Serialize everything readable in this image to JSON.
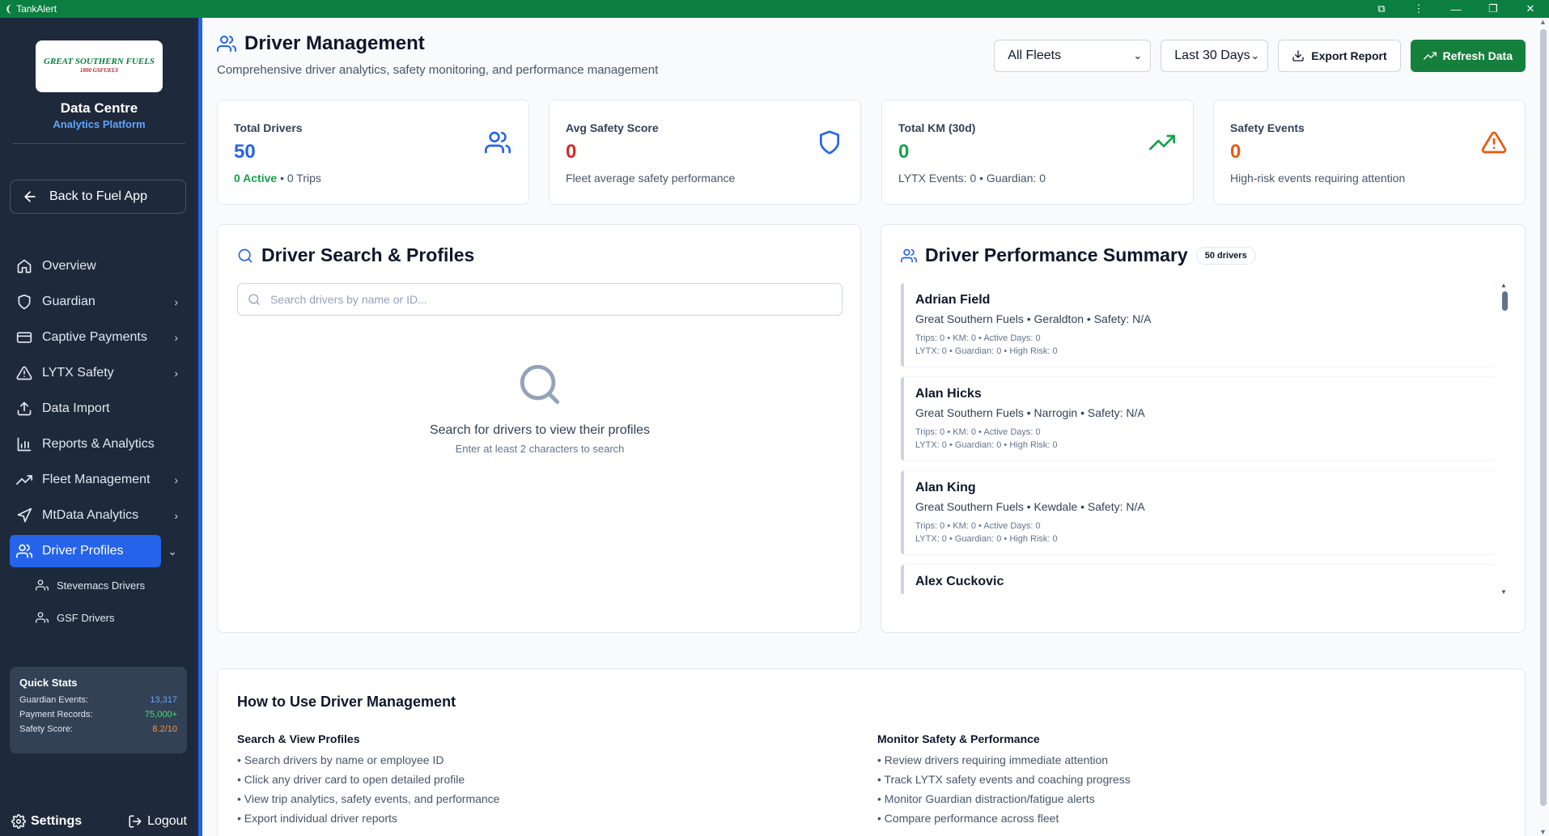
{
  "window": {
    "title": "TankAlert"
  },
  "sidebar": {
    "brand_title": "Data Centre",
    "brand_subtitle": "Analytics Platform",
    "logo_line1": "GREAT SOUTHERN FUELS",
    "logo_line2": "1800 GSFUELS",
    "back_label": "Back to Fuel App",
    "nav": [
      {
        "label": "Overview",
        "icon": "home-icon"
      },
      {
        "label": "Guardian",
        "icon": "shield-icon"
      },
      {
        "label": "Captive Payments",
        "icon": "credit-card-icon"
      },
      {
        "label": "LYTX Safety",
        "icon": "alert-triangle-icon"
      },
      {
        "label": "Data Import",
        "icon": "upload-icon"
      },
      {
        "label": "Reports & Analytics",
        "icon": "bar-chart-icon"
      },
      {
        "label": "Fleet Management",
        "icon": "trending-up-icon"
      },
      {
        "label": "MtData Analytics",
        "icon": "navigation-icon"
      },
      {
        "label": "Driver Profiles",
        "icon": "users-icon"
      }
    ],
    "subnav": [
      {
        "label": "Stevemacs Drivers"
      },
      {
        "label": "GSF Drivers"
      }
    ],
    "quick_stats": {
      "title": "Quick Stats",
      "rows": [
        {
          "label": "Guardian Events:",
          "value": "13,317",
          "color": "#60a5fa"
        },
        {
          "label": "Payment Records:",
          "value": "75,000+",
          "color": "#4ade80"
        },
        {
          "label": "Safety Score:",
          "value": "8.2/10",
          "color": "#fb923c"
        }
      ]
    },
    "settings_label": "Settings",
    "logout_label": "Logout"
  },
  "header": {
    "title": "Driver Management",
    "description": "Comprehensive driver analytics, safety monitoring, and performance management",
    "fleet_select": "All Fleets",
    "period_select": "Last 30 Days",
    "export_label": "Export Report",
    "refresh_label": "Refresh Data"
  },
  "stats": [
    {
      "label": "Total Drivers",
      "value": "50",
      "sub_a": "0 Active",
      "sub_b": " • 0 Trips",
      "color": "#2563eb",
      "icon": "users-icon"
    },
    {
      "label": "Avg Safety Score",
      "value": "0",
      "sub": "Fleet average safety performance",
      "color": "#dc2626",
      "icon": "shield-icon"
    },
    {
      "label": "Total KM (30d)",
      "value": "0",
      "sub": "LYTX Events: 0 • Guardian: 0",
      "color": "#16a34a",
      "icon": "trending-up-icon"
    },
    {
      "label": "Safety Events",
      "value": "0",
      "sub": "High-risk events requiring attention",
      "color": "#ea580c",
      "icon": "alert-triangle-icon"
    }
  ],
  "search_panel": {
    "title": "Driver Search & Profiles",
    "placeholder": "Search drivers by name or ID...",
    "empty_title": "Search for drivers to view their profiles",
    "empty_hint": "Enter at least 2 characters to search"
  },
  "summary_panel": {
    "title": "Driver Performance Summary",
    "badge": "50 drivers",
    "drivers": [
      {
        "name": "Adrian Field",
        "meta": "Great Southern Fuels • Geraldton • Safety: N/A",
        "line1": "Trips: 0 • KM: 0 • Active Days: 0",
        "line2": "LYTX: 0 • Guardian: 0 • High Risk: 0"
      },
      {
        "name": "Alan Hicks",
        "meta": "Great Southern Fuels • Narrogin • Safety: N/A",
        "line1": "Trips: 0 • KM: 0 • Active Days: 0",
        "line2": "LYTX: 0 • Guardian: 0 • High Risk: 0"
      },
      {
        "name": "Alan King",
        "meta": "Great Southern Fuels • Kewdale • Safety: N/A",
        "line1": "Trips: 0 • KM: 0 • Active Days: 0",
        "line2": "LYTX: 0 • Guardian: 0 • High Risk: 0"
      },
      {
        "name": "Alex Cuckovic",
        "meta": "",
        "line1": "",
        "line2": ""
      }
    ]
  },
  "howto": {
    "title": "How to Use Driver Management",
    "left": {
      "heading": "Search & View Profiles",
      "items": [
        "• Search drivers by name or employee ID",
        "• Click any driver card to open detailed profile",
        "• View trip analytics, safety events, and performance",
        "• Export individual driver reports"
      ]
    },
    "right": {
      "heading": "Monitor Safety & Performance",
      "items": [
        "• Review drivers requiring immediate attention",
        "• Track LYTX safety events and coaching progress",
        "• Monitor Guardian distraction/fatigue alerts",
        "• Compare performance across fleet"
      ]
    }
  }
}
